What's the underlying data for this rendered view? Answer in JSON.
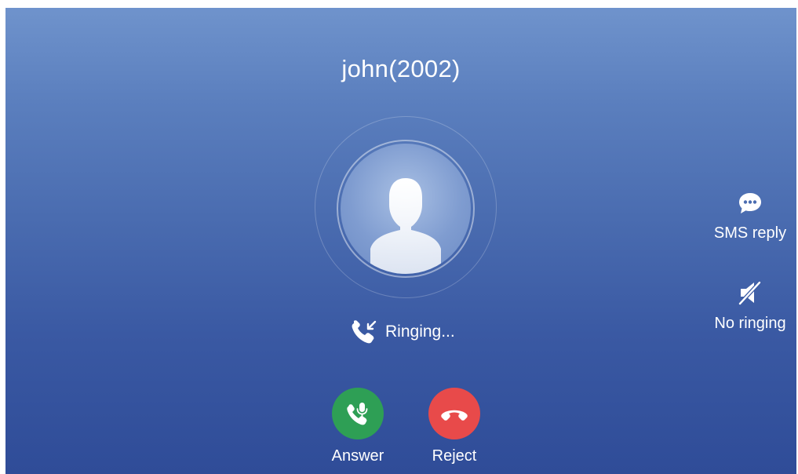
{
  "call": {
    "caller": "john(2002)",
    "status": "Ringing..."
  },
  "actions": {
    "answer_label": "Answer",
    "reject_label": "Reject"
  },
  "side_actions": {
    "sms_reply_label": "SMS reply",
    "no_ringing_label": "No ringing"
  },
  "icons": {
    "avatar": "person-silhouette-icon",
    "status": "incoming-call-icon",
    "answer": "phone-answer-icon",
    "reject": "phone-hangup-icon",
    "sms_reply": "chat-bubble-icon",
    "no_ringing": "speaker-mute-icon"
  },
  "colors": {
    "answer": "#2e9f55",
    "reject": "#e84a4a",
    "background_top": "#6f93cc",
    "background_bottom": "#2f4c98"
  }
}
